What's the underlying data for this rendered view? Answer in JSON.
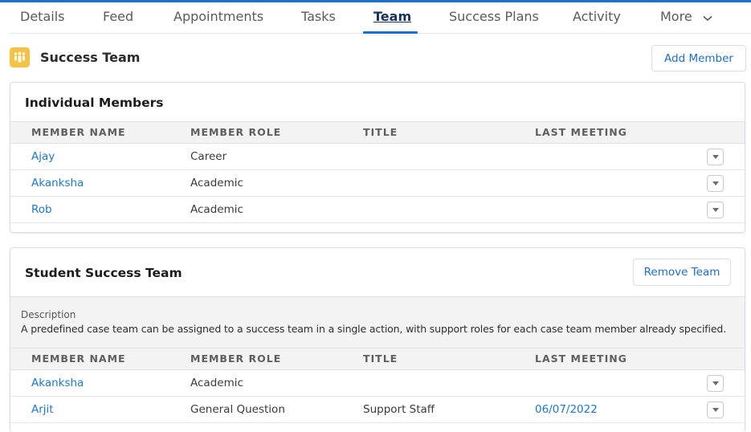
{
  "tabs": [
    {
      "label": "Details",
      "active": false
    },
    {
      "label": "Feed",
      "active": false
    },
    {
      "label": "Appointments",
      "active": false
    },
    {
      "label": "Tasks",
      "active": false
    },
    {
      "label": "Team",
      "active": true
    },
    {
      "label": "Success Plans",
      "active": false
    },
    {
      "label": "Activity",
      "active": false
    },
    {
      "label": "More",
      "active": false,
      "icon": "chevron-down-icon"
    }
  ],
  "header": {
    "icon": "team-icon",
    "title": "Success Team",
    "add_member_label": "Add Member"
  },
  "individual_members": {
    "title": "Individual Members",
    "columns": [
      "MEMBER NAME",
      "MEMBER ROLE",
      "TITLE",
      "LAST MEETING"
    ],
    "rows": [
      {
        "name": "Ajay",
        "role": "Career",
        "title": "",
        "last_meeting": ""
      },
      {
        "name": "Akanksha",
        "role": "Academic",
        "title": "",
        "last_meeting": ""
      },
      {
        "name": "Rob",
        "role": "Academic",
        "title": "",
        "last_meeting": ""
      }
    ]
  },
  "student_success_team": {
    "title": "Student Success Team",
    "remove_team_label": "Remove Team",
    "description_label": "Description",
    "description_text": "A predefined case team can be assigned to a success team in a single action, with support roles for each case team member already specified.",
    "columns": [
      "MEMBER NAME",
      "MEMBER ROLE",
      "TITLE",
      "LAST MEETING"
    ],
    "rows": [
      {
        "name": "Akanksha",
        "role": "Academic",
        "title": "",
        "last_meeting": ""
      },
      {
        "name": "Arjit",
        "role": "General Question",
        "title": "Support Staff",
        "last_meeting": "06/07/2022"
      }
    ]
  },
  "colors": {
    "accent": "#1b6fd0",
    "link": "#1b78d0",
    "team_icon_bg": "#f4c343"
  }
}
